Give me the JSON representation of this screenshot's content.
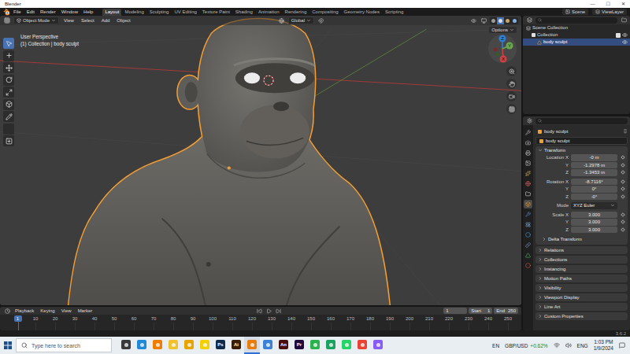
{
  "window": {
    "title": "Blender",
    "controls": [
      "—",
      "☐",
      "✕"
    ]
  },
  "topbar": {
    "menus": [
      "File",
      "Edit",
      "Render",
      "Window",
      "Help"
    ],
    "workspaces": [
      {
        "label": "Layout",
        "selected": true
      },
      {
        "label": "Modeling",
        "selected": false
      },
      {
        "label": "Sculpting",
        "selected": false
      },
      {
        "label": "UV Editing",
        "selected": false
      },
      {
        "label": "Texture Paint",
        "selected": false
      },
      {
        "label": "Shading",
        "selected": false
      },
      {
        "label": "Animation",
        "selected": false
      },
      {
        "label": "Rendering",
        "selected": false
      },
      {
        "label": "Compositing",
        "selected": false
      },
      {
        "label": "Geometry Nodes",
        "selected": false
      },
      {
        "label": "Scripting",
        "selected": false
      }
    ],
    "scene": "Scene",
    "view_layer": "ViewLayer"
  },
  "viewport": {
    "mode": "Object Mode",
    "menus": [
      "View",
      "Select",
      "Add",
      "Object"
    ],
    "orientation": "Global",
    "options": "Options",
    "info": [
      "User Perspective",
      "(1) Collection | body sculpt"
    ],
    "gizmo": [
      "X",
      "Y",
      "Z"
    ],
    "tools": [
      {
        "selected": true
      },
      {
        "selected": false
      },
      {
        "selected": false
      },
      {
        "selected": false
      },
      {
        "selected": false
      },
      {
        "selected": false
      },
      {
        "selected": false
      },
      {
        "selected": false
      },
      {
        "selected": false
      }
    ],
    "shading_modes": [
      {
        "selected": false
      },
      {
        "selected": true
      },
      {
        "selected": false
      },
      {
        "selected": false
      }
    ]
  },
  "outliner": {
    "items": [
      {
        "label": "Scene Collection",
        "kind": "scene",
        "depth": 0,
        "selected": false
      },
      {
        "label": "Collection",
        "kind": "collection",
        "depth": 1,
        "selected": false,
        "checked": true,
        "visible": true
      },
      {
        "label": "body sculpt",
        "kind": "object",
        "depth": 2,
        "selected": true,
        "visible": true
      }
    ]
  },
  "properties": {
    "tabs": [
      {
        "color": "#b8b8b8",
        "selected": false
      },
      {
        "color": "#c4c4c4",
        "selected": false
      },
      {
        "color": "#c4c4c4",
        "selected": false
      },
      {
        "color": "#c4c4c4",
        "selected": false
      },
      {
        "color": "#d2a868",
        "selected": false
      },
      {
        "color": "#d65a5a",
        "selected": false
      },
      {
        "color": "#e0e0e0",
        "selected": false
      },
      {
        "color": "#f0a030",
        "selected": true
      },
      {
        "color": "#5f8fdf",
        "selected": false
      },
      {
        "color": "#8cb3e6",
        "selected": false
      },
      {
        "color": "#4aa0e0",
        "selected": false
      },
      {
        "color": "#8a9bd0",
        "selected": false
      },
      {
        "color": "#4fbf6a",
        "selected": false
      },
      {
        "color": "#d85050",
        "selected": false
      }
    ],
    "object": "body sculpt",
    "name_field": "body sculpt",
    "transform": {
      "title": "Transform",
      "expanded": true,
      "groups": [
        [
          {
            "label": "Location X",
            "value": "-0 m",
            "kind": "number"
          },
          {
            "label": "Y",
            "value": "-1.2978 m",
            "kind": "number"
          },
          {
            "label": "Z",
            "value": "-1.3453 m",
            "kind": "number"
          }
        ],
        [
          {
            "label": "Rotation X",
            "value": "-8.7116°",
            "kind": "number"
          },
          {
            "label": "Y",
            "value": "0°",
            "kind": "number"
          },
          {
            "label": "Z",
            "value": "-0°",
            "kind": "number"
          }
        ],
        [
          {
            "label": "Mode",
            "value": "XYZ Euler",
            "kind": "dropdown"
          }
        ],
        [
          {
            "label": "Scale X",
            "value": "3.000",
            "kind": "number"
          },
          {
            "label": "Y",
            "value": "3.000",
            "kind": "number"
          },
          {
            "label": "Z",
            "value": "3.000",
            "kind": "number"
          }
        ]
      ],
      "subpanel": {
        "title": "Delta Transform",
        "expanded": false
      }
    },
    "panels": [
      {
        "title": "Relations",
        "expanded": false
      },
      {
        "title": "Collections",
        "expanded": false
      },
      {
        "title": "Instancing",
        "expanded": false
      },
      {
        "title": "Motion Paths",
        "expanded": false
      },
      {
        "title": "Visibility",
        "expanded": false
      },
      {
        "title": "Viewport Display",
        "expanded": false
      },
      {
        "title": "Line Art",
        "expanded": false
      },
      {
        "title": "Custom Properties",
        "expanded": false
      }
    ]
  },
  "timeline": {
    "menus": [
      "Playback",
      "Keying",
      "View",
      "Marker"
    ],
    "current_frame": "1",
    "start": {
      "label": "Start",
      "value": "1"
    },
    "end": {
      "label": "End",
      "value": "250"
    },
    "ticks": [
      "10",
      "20",
      "30",
      "40",
      "50",
      "60",
      "70",
      "80",
      "90",
      "100",
      "110",
      "120",
      "130",
      "140",
      "150",
      "160",
      "170",
      "180",
      "190",
      "200",
      "210",
      "220",
      "230",
      "240",
      "250"
    ]
  },
  "status_bar": {
    "version": "3.6.2"
  },
  "taskbar": {
    "search_placeholder": "Type here to search",
    "apps": [
      {
        "label": "",
        "color": "#3a3a3a",
        "selected": false
      },
      {
        "label": "",
        "color": "#1f8ad8",
        "selected": false
      },
      {
        "label": "",
        "color": "#f07d00",
        "selected": false
      },
      {
        "label": "",
        "color": "#f2c12e",
        "selected": false
      },
      {
        "label": "",
        "color": "#e8a400",
        "selected": false
      },
      {
        "label": "",
        "color": "#f5d000",
        "selected": false
      },
      {
        "label": "Ps",
        "color": "#0f2a4a",
        "selected": false
      },
      {
        "label": "Ai",
        "color": "#3b1e00",
        "selected": false
      },
      {
        "label": "",
        "color": "#e87d0d",
        "selected": true
      },
      {
        "label": "",
        "color": "#3b82d6",
        "selected": false
      },
      {
        "label": "An",
        "color": "#4a0d0d",
        "selected": false
      },
      {
        "label": "Pr",
        "color": "#1f0a3a",
        "selected": false
      },
      {
        "label": "",
        "color": "#2bb24c",
        "selected": false
      },
      {
        "label": "",
        "color": "#1aa260",
        "selected": false
      },
      {
        "label": "",
        "color": "#25d366",
        "selected": false
      },
      {
        "label": "",
        "color": "#ea4335",
        "selected": false
      },
      {
        "label": "",
        "color": "#8a5cf6",
        "selected": false
      }
    ],
    "tray": {
      "language": "EN",
      "ticker": {
        "label": "GBP/USD",
        "change": "+0.62%"
      },
      "keyboard": "ENG",
      "time": "1:03 PM",
      "date": "1/9/2024"
    }
  }
}
